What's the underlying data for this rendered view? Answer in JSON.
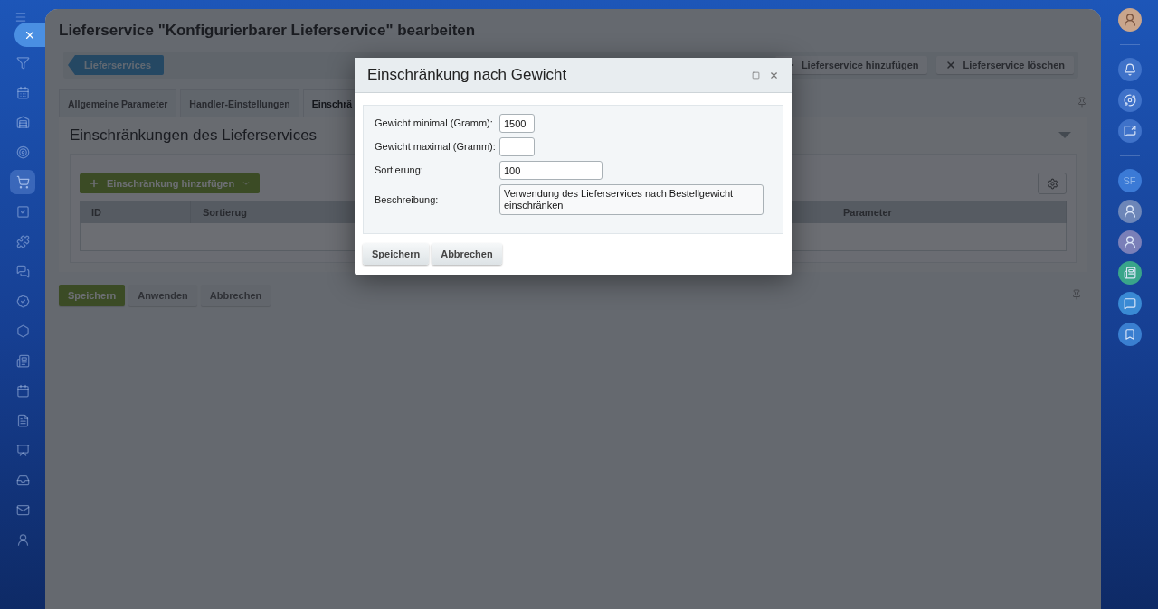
{
  "page": {
    "title": "Lieferservice \"Konfigurierbarer Lieferservice\" bearbeiten"
  },
  "left_sidebar": {
    "items": [
      {
        "selected": false
      },
      {
        "selected": false
      },
      {
        "selected": false
      },
      {
        "selected": false
      },
      {
        "selected": true
      },
      {
        "selected": false
      },
      {
        "selected": false
      },
      {
        "selected": false
      },
      {
        "selected": false
      },
      {
        "selected": false
      },
      {
        "selected": false
      },
      {
        "selected": false
      },
      {
        "selected": false
      },
      {
        "selected": false
      },
      {
        "selected": false
      },
      {
        "selected": false
      },
      {
        "selected": false
      }
    ]
  },
  "right_sidebar": {
    "initials": "SF"
  },
  "toolbar": {
    "breadcrumb": "Lieferservices",
    "buttons": [
      "Lieferservice hinzufügen",
      "Lieferservice löschen"
    ]
  },
  "tabs": [
    {
      "label": "Allgemeine Parameter",
      "selected": false
    },
    {
      "label": "Handler-Einstellungen",
      "selected": false
    },
    {
      "label": "Einschrä",
      "selected": true
    }
  ],
  "section": {
    "title": "Einschränkungen des Lieferservices",
    "add_button": "Einschränkung hinzufügen",
    "table": {
      "columns": [
        "ID",
        "Sortierug",
        "Parameter"
      ]
    }
  },
  "form_buttons": [
    {
      "label": "Speichern",
      "kind": "primary"
    },
    {
      "label": "Anwenden",
      "kind": "default"
    },
    {
      "label": "Abbrechen",
      "kind": "default"
    }
  ],
  "dialog": {
    "title": "Einschränkung nach Gewicht",
    "fields": [
      {
        "label": "Gewicht minimal (Gramm):",
        "value": "1500",
        "kind": "short"
      },
      {
        "label": "Gewicht maximal (Gramm):",
        "kind": "short"
      },
      {
        "label": "Sortierung:",
        "value": "100",
        "kind": "medium"
      },
      {
        "label": "Beschreibung:",
        "value": "Verwendung des Lieferservices nach Bestellgewicht einschränken",
        "kind": "textarea"
      }
    ],
    "buttons": [
      "Speichern",
      "Abbrechen"
    ]
  }
}
